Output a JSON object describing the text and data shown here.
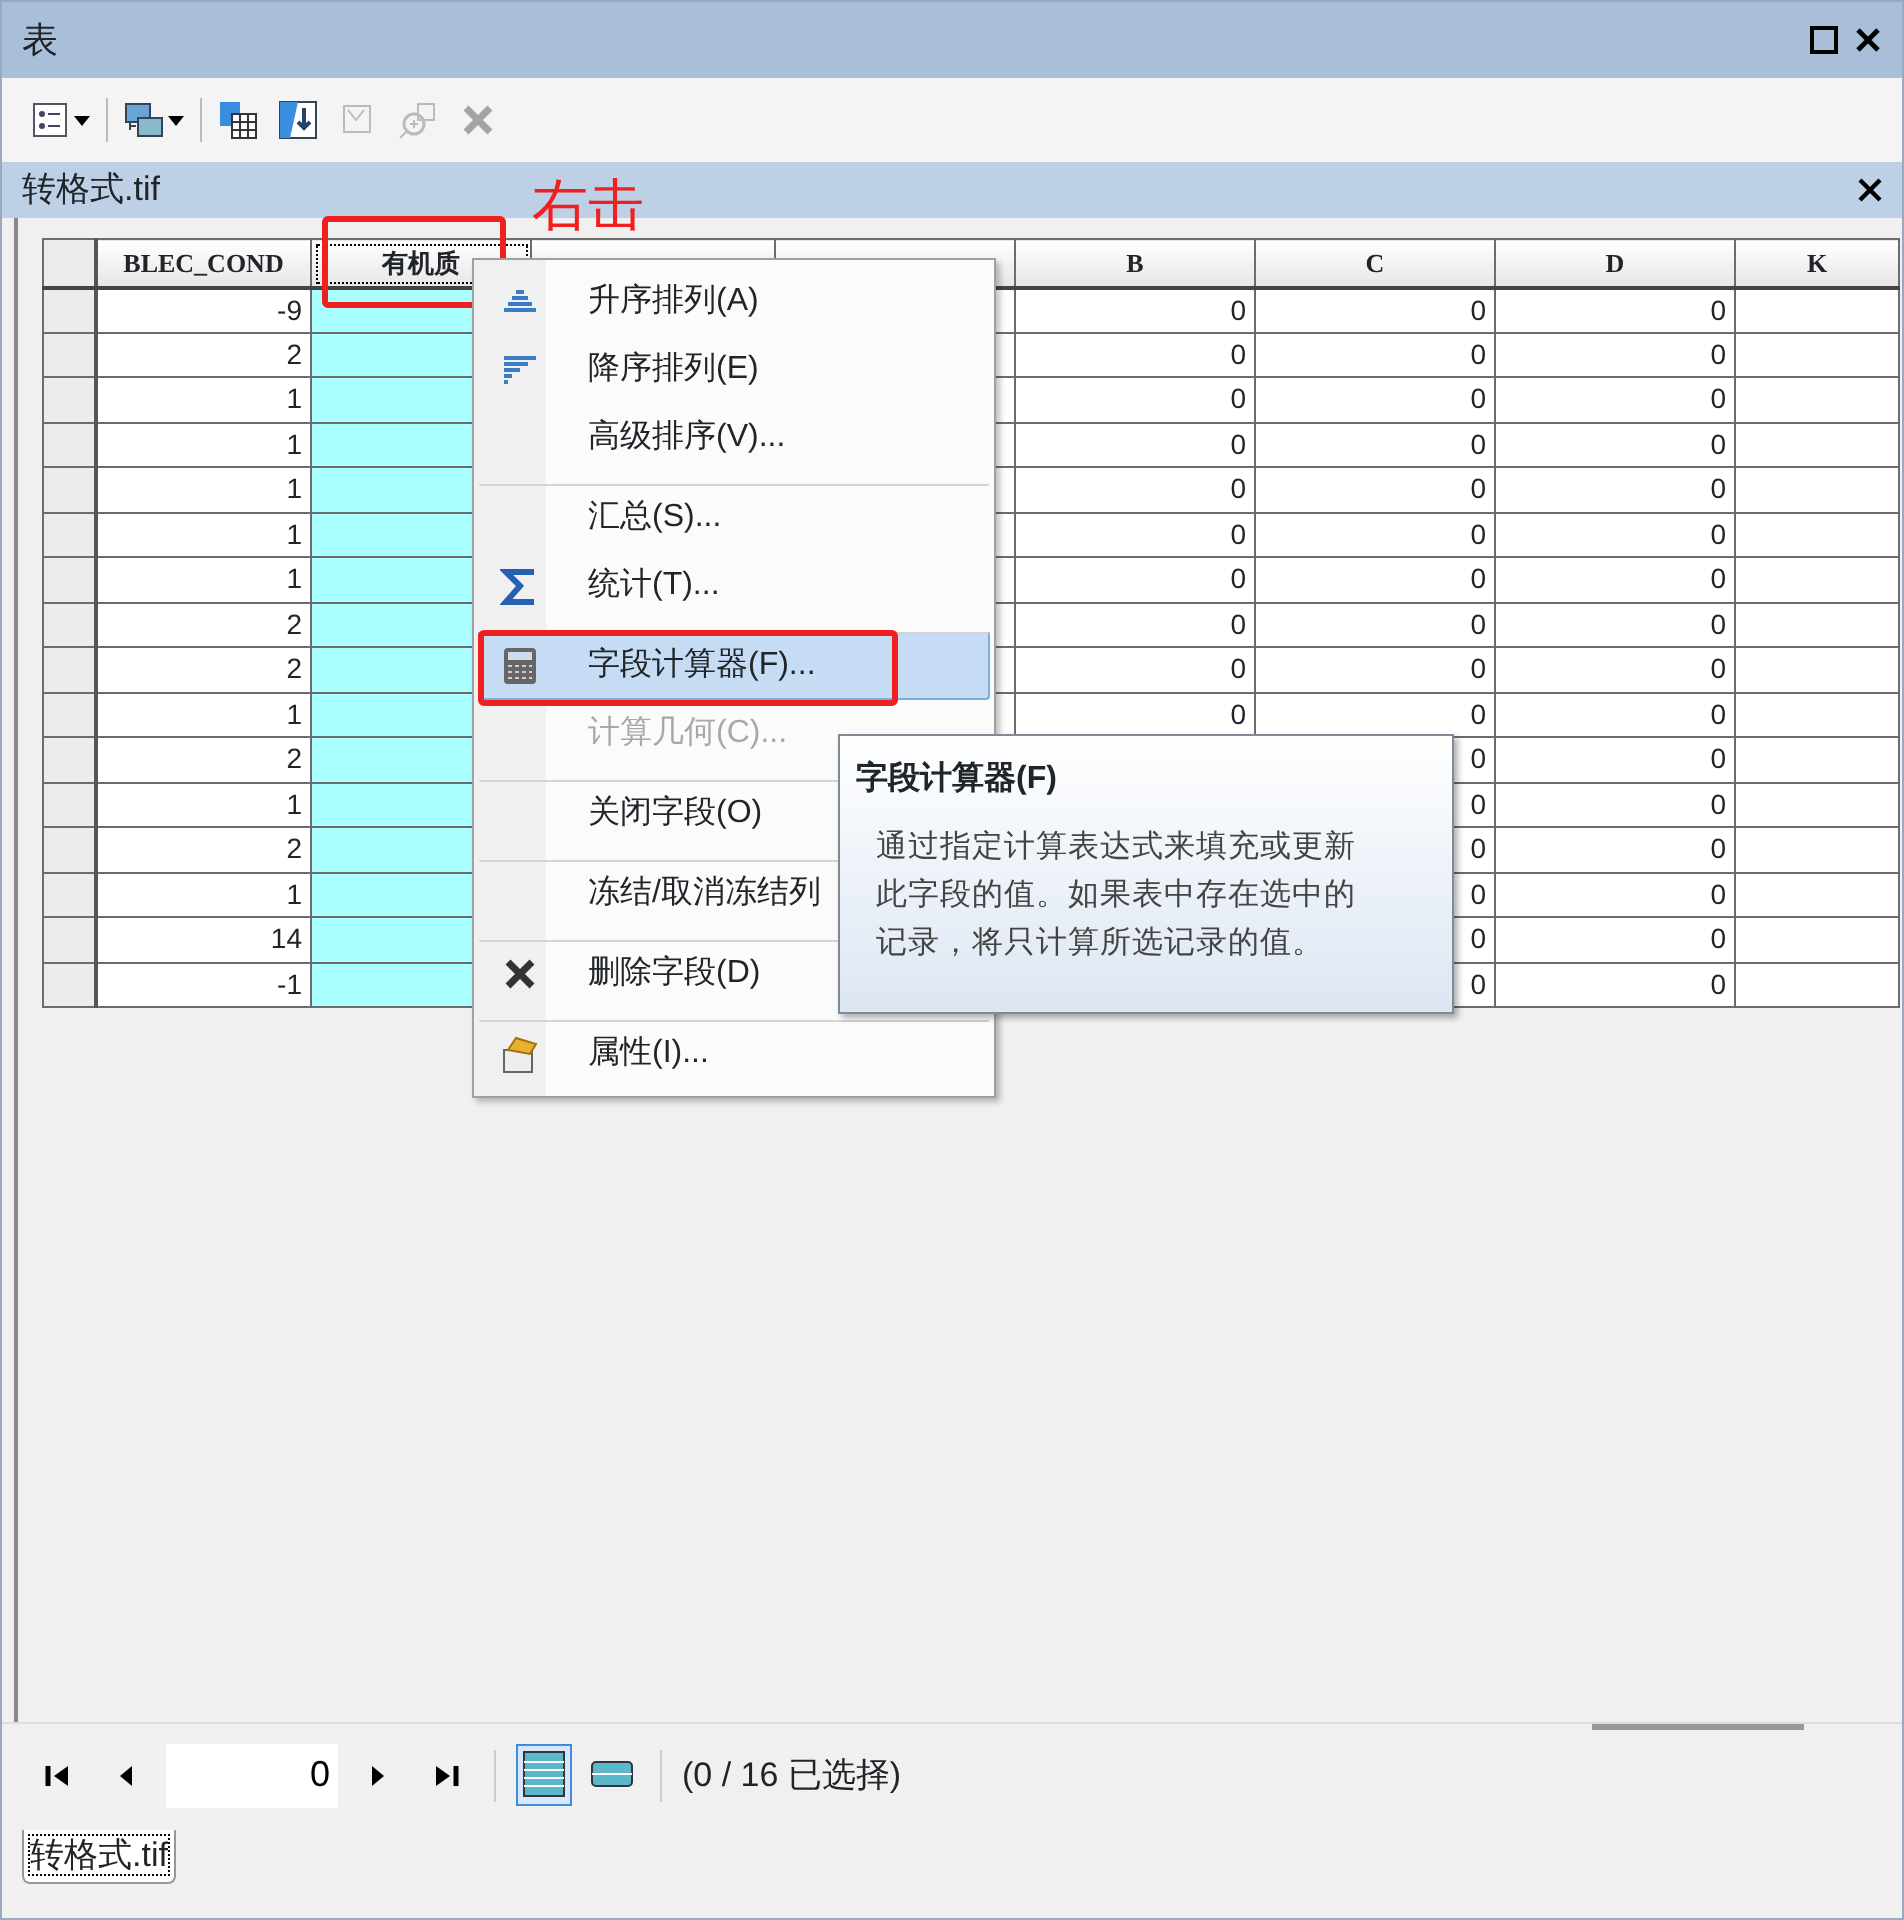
{
  "window": {
    "title": "表"
  },
  "toolbar": [
    {
      "kind": "table-options",
      "dropdown": true,
      "disabled": false
    },
    {
      "kind": "related-tables",
      "dropdown": true,
      "disabled": false
    },
    {
      "kind": "select-by-attributes",
      "dropdown": false,
      "disabled": false
    },
    {
      "kind": "switch-selection",
      "dropdown": false,
      "disabled": false
    },
    {
      "kind": "clear-selection",
      "dropdown": false,
      "disabled": true
    },
    {
      "kind": "zoom-to-selected",
      "dropdown": false,
      "disabled": true
    },
    {
      "kind": "delete-selected",
      "dropdown": false,
      "disabled": true
    }
  ],
  "table_window": {
    "title": "转格式.tif"
  },
  "table": {
    "columns": [
      {
        "label": "BLEC_COND",
        "selected": false,
        "annotated": false
      },
      {
        "label": "有机质",
        "selected": true,
        "annotated": true
      },
      {
        "selected": false,
        "annotated": false
      },
      {
        "selected": false,
        "annotated": false
      },
      {
        "label": "B",
        "selected": false,
        "annotated": false
      },
      {
        "label": "C",
        "selected": false,
        "annotated": false
      },
      {
        "label": "D",
        "selected": false,
        "annotated": false
      },
      {
        "label": "K",
        "selected": false,
        "annotated": false
      }
    ],
    "rows": [
      {
        "cells": [
          "-9",
          null,
          null,
          null,
          "0",
          "0",
          "0",
          null
        ]
      },
      {
        "cells": [
          "2",
          null,
          null,
          null,
          "0",
          "0",
          "0",
          null
        ]
      },
      {
        "cells": [
          "1",
          null,
          null,
          null,
          "0",
          "0",
          "0",
          null
        ]
      },
      {
        "cells": [
          "1",
          null,
          null,
          null,
          "0",
          "0",
          "0",
          null
        ]
      },
      {
        "cells": [
          "1",
          null,
          null,
          null,
          "0",
          "0",
          "0",
          null
        ]
      },
      {
        "cells": [
          "1",
          null,
          null,
          null,
          "0",
          "0",
          "0",
          null
        ]
      },
      {
        "cells": [
          "1",
          null,
          null,
          null,
          "0",
          "0",
          "0",
          null
        ]
      },
      {
        "cells": [
          "2",
          null,
          null,
          null,
          "0",
          "0",
          "0",
          null
        ]
      },
      {
        "cells": [
          "2",
          null,
          null,
          null,
          "0",
          "0",
          "0",
          null
        ]
      },
      {
        "cells": [
          "1",
          null,
          null,
          null,
          "0",
          "0",
          "0",
          null
        ]
      },
      {
        "cells": [
          "2",
          null,
          null,
          null,
          null,
          "0",
          "0",
          null
        ]
      },
      {
        "cells": [
          "1",
          null,
          null,
          null,
          null,
          "0",
          "0",
          null
        ]
      },
      {
        "cells": [
          "2",
          null,
          null,
          null,
          null,
          "0",
          "0",
          null
        ]
      },
      {
        "cells": [
          "1",
          null,
          null,
          null,
          null,
          "0",
          "0",
          null
        ]
      },
      {
        "cells": [
          "14",
          null,
          null,
          null,
          null,
          "0",
          "0",
          null
        ]
      },
      {
        "cells": [
          "-1",
          null,
          null,
          null,
          null,
          "0",
          "0",
          null
        ]
      }
    ]
  },
  "annotation": {
    "label": "右击"
  },
  "context_menu": [
    {
      "label": "升序排列(A)",
      "kind": "sort-ascending",
      "separator_before": false,
      "disabled": false,
      "highlighted": false,
      "annotated": false
    },
    {
      "label": "降序排列(E)",
      "kind": "sort-descending",
      "separator_before": false,
      "disabled": false,
      "highlighted": false,
      "annotated": false
    },
    {
      "label": "高级排序(V)...",
      "kind": "plain",
      "separator_before": false,
      "disabled": false,
      "highlighted": false,
      "annotated": false
    },
    {
      "label": "汇总(S)...",
      "kind": "plain",
      "separator_before": true,
      "disabled": false,
      "highlighted": false,
      "annotated": false
    },
    {
      "label": "统计(T)...",
      "kind": "sigma",
      "separator_before": false,
      "disabled": false,
      "highlighted": false,
      "annotated": false
    },
    {
      "label": "字段计算器(F)...",
      "kind": "calculator",
      "separator_before": true,
      "disabled": false,
      "highlighted": true,
      "annotated": true
    },
    {
      "label": "计算几何(C)...",
      "kind": "plain",
      "separator_before": false,
      "disabled": true,
      "highlighted": false,
      "annotated": false
    },
    {
      "label": "关闭字段(O)",
      "kind": "plain",
      "separator_before": true,
      "disabled": false,
      "highlighted": false,
      "annotated": false
    },
    {
      "label": "冻结/取消冻结列",
      "kind": "plain",
      "separator_before": true,
      "disabled": false,
      "highlighted": false,
      "annotated": false
    },
    {
      "label": "删除字段(D)",
      "kind": "delete",
      "separator_before": true,
      "disabled": false,
      "highlighted": false,
      "annotated": false
    },
    {
      "label": "属性(I)...",
      "kind": "properties",
      "separator_before": true,
      "disabled": false,
      "highlighted": false,
      "annotated": false
    }
  ],
  "tooltip": {
    "title": "字段计算器(F)",
    "text": "通过指定计算表达式来填充或更新此字段的值。如果表中存在选中的记录，将只计算所选记录的值。"
  },
  "footer": {
    "record": "0",
    "views": [
      {
        "kind": "all-records",
        "selected": true
      },
      {
        "kind": "selected-records",
        "selected": false
      }
    ],
    "status": "(0 / 16 已选择)"
  },
  "bottom_tab": {
    "label": "转格式.tif",
    "selected": true
  }
}
